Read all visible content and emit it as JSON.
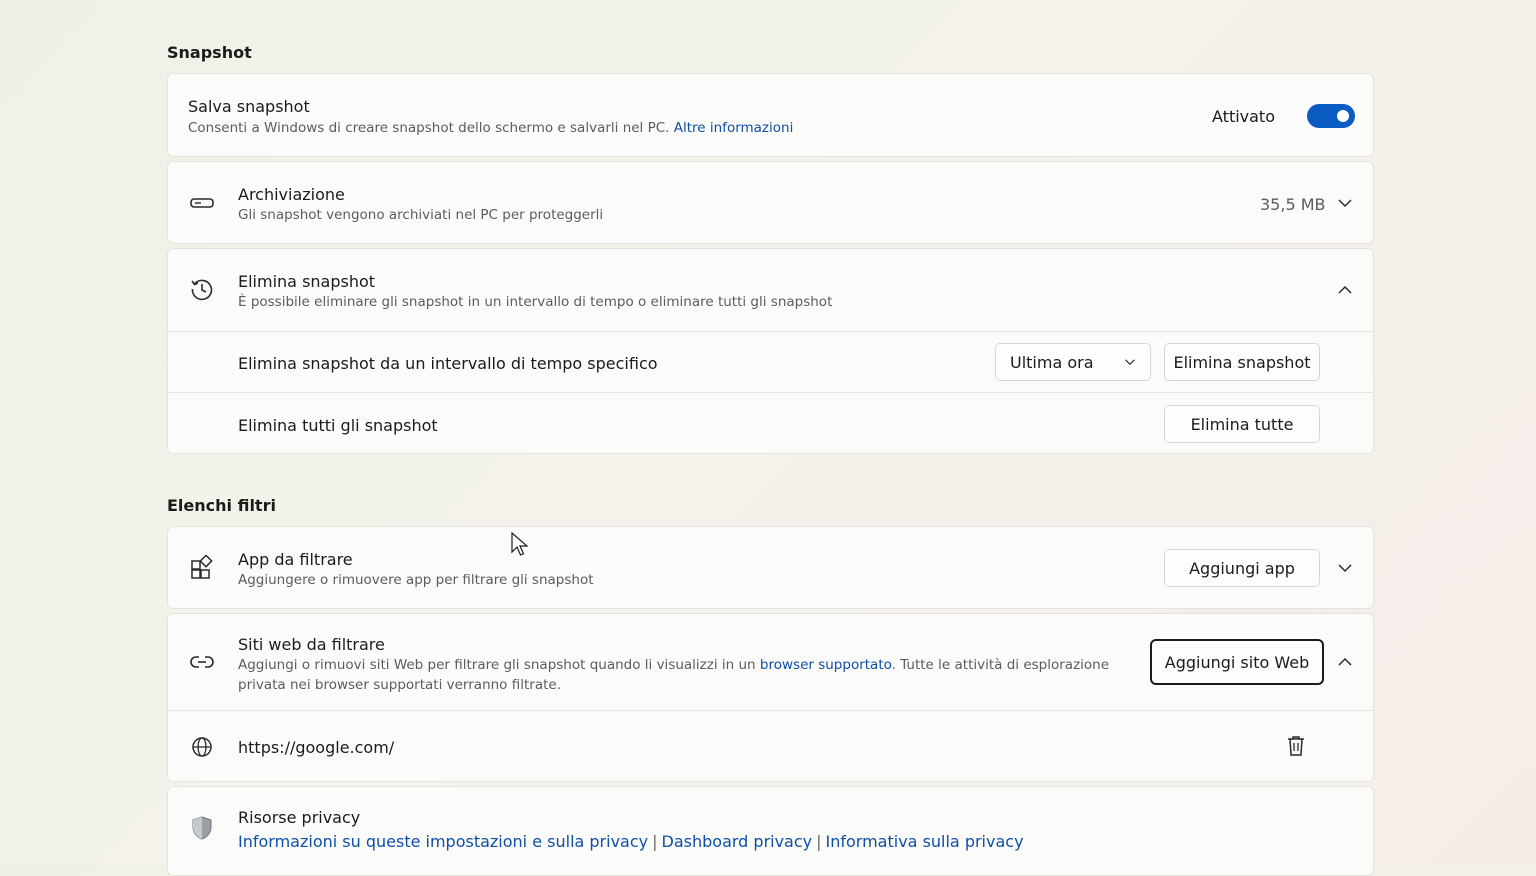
{
  "snapshot_section": {
    "heading": "Snapshot",
    "save": {
      "title": "Salva snapshot",
      "desc": "Consenti a Windows di creare snapshot dello schermo e salvarli nel PC.",
      "link": "Altre informazioni",
      "state_label": "Attivato",
      "toggle_on": true
    },
    "storage": {
      "title": "Archiviazione",
      "desc": "Gli snapshot vengono archiviati nel PC per proteggerli",
      "size": "35,5 MB"
    },
    "delete": {
      "title": "Elimina snapshot",
      "desc": "È possibile eliminare gli snapshot in un intervallo di tempo o eliminare tutti gli snapshot",
      "range_label": "Elimina snapshot da un intervallo di tempo specifico",
      "range_select": "Ultima ora",
      "range_button": "Elimina snapshot",
      "all_label": "Elimina tutti gli snapshot",
      "all_button": "Elimina tutte"
    }
  },
  "filters_section": {
    "heading": "Elenchi filtri",
    "apps": {
      "title": "App da filtrare",
      "desc": "Aggiungere o rimuovere app per filtrare gli snapshot",
      "button": "Aggiungi app"
    },
    "sites": {
      "title": "Siti web da filtrare",
      "desc_1": "Aggiungi o rimuovi siti Web per filtrare gli snapshot quando li visualizzi in un",
      "desc_link": "browser supportato",
      "desc_2": ". Tutte le attività di esplorazione",
      "desc_3": "privata nei browser supportati verranno filtrate.",
      "button": "Aggiungi sito Web",
      "entries": [
        "https://google.com/"
      ]
    }
  },
  "privacy": {
    "title": "Risorse privacy",
    "links": [
      "Informazioni su queste impostazioni e sulla privacy",
      "Dashboard privacy",
      "Informativa sulla privacy"
    ]
  },
  "colors": {
    "accent": "#0a5cc2",
    "link": "#0f4fa8"
  },
  "icons": [
    "storage-icon",
    "history-icon",
    "apps-icon",
    "link-icon",
    "globe-icon",
    "delete-icon",
    "shield-icon",
    "chevron-down-icon",
    "chevron-up-icon"
  ]
}
